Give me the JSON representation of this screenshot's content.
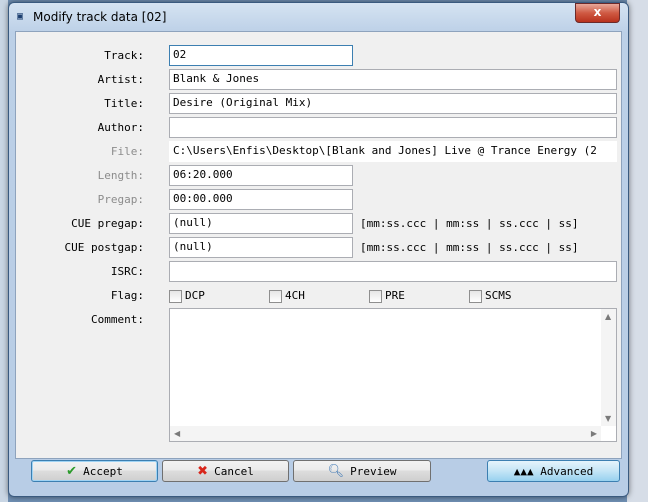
{
  "window": {
    "title": "Modify track data [02]",
    "close_glyph": "x"
  },
  "form": {
    "track": {
      "label": "Track:",
      "value": "02"
    },
    "artist": {
      "label": "Artist:",
      "value": "Blank & Jones"
    },
    "title": {
      "label": "Title:",
      "value": "Desire (Original Mix)"
    },
    "author": {
      "label": "Author:",
      "value": ""
    },
    "file": {
      "label": "File:",
      "value": "C:\\Users\\Enfis\\Desktop\\[Blank and Jones] Live @ Trance Energy (2"
    },
    "length": {
      "label": "Length:",
      "value": "06:20.000"
    },
    "pregap": {
      "label": "Pregap:",
      "value": "00:00.000"
    },
    "cue_pregap": {
      "label": "CUE pregap:",
      "value": "(null)",
      "hint": "[mm:ss.ccc | mm:ss | ss.ccc | ss]"
    },
    "cue_postgap": {
      "label": "CUE postgap:",
      "value": "(null)",
      "hint": "[mm:ss.ccc | mm:ss | ss.ccc | ss]"
    },
    "isrc": {
      "label": "ISRC:",
      "value": ""
    },
    "flag": {
      "label": "Flag:",
      "options": [
        "DCP",
        "4CH",
        "PRE",
        "SCMS"
      ]
    },
    "comment": {
      "label": "Comment:",
      "value": ""
    }
  },
  "buttons": {
    "accept": "Accept",
    "cancel": "Cancel",
    "preview": "Preview",
    "advanced": "▲▲▲ Advanced"
  }
}
